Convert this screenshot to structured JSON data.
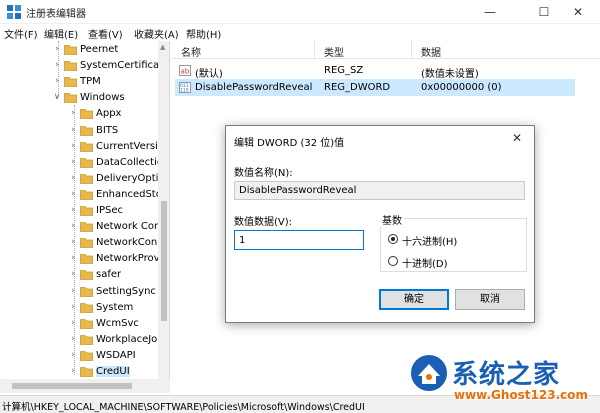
{
  "window": {
    "title": "注册表编辑器"
  },
  "menu": [
    "文件(F)",
    "编辑(E)",
    "查看(V)",
    "收藏夹(A)",
    "帮助(H)"
  ],
  "tree": {
    "items": [
      {
        "label": "Peernet",
        "indent": 1,
        "expanded": false
      },
      {
        "label": "SystemCertificate",
        "indent": 1,
        "expanded": false
      },
      {
        "label": "TPM",
        "indent": 1,
        "expanded": false
      },
      {
        "label": "Windows",
        "indent": 1,
        "expanded": true
      },
      {
        "label": "Appx",
        "indent": 2,
        "expanded": false
      },
      {
        "label": "BITS",
        "indent": 2,
        "expanded": false
      },
      {
        "label": "CurrentVersio",
        "indent": 2,
        "expanded": false
      },
      {
        "label": "DataCollection",
        "indent": 2,
        "expanded": false
      },
      {
        "label": "DeliveryOptin",
        "indent": 2,
        "expanded": false
      },
      {
        "label": "EnhancedStor",
        "indent": 2,
        "expanded": false
      },
      {
        "label": "IPSec",
        "indent": 2,
        "expanded": false
      },
      {
        "label": "Network Con",
        "indent": 2,
        "expanded": false
      },
      {
        "label": "NetworkConn",
        "indent": 2,
        "expanded": false
      },
      {
        "label": "NetworkProv",
        "indent": 2,
        "expanded": false
      },
      {
        "label": "safer",
        "indent": 2,
        "expanded": false
      },
      {
        "label": "SettingSync",
        "indent": 2,
        "expanded": false
      },
      {
        "label": "System",
        "indent": 2,
        "expanded": false
      },
      {
        "label": "WcmSvc",
        "indent": 2,
        "expanded": false
      },
      {
        "label": "WorkplaceJo",
        "indent": 2,
        "expanded": false
      },
      {
        "label": "WSDAPI",
        "indent": 2,
        "expanded": false
      },
      {
        "label": "CredUI",
        "indent": 2,
        "expanded": false,
        "selected": true
      }
    ]
  },
  "list": {
    "columns": [
      "名称",
      "类型",
      "数据"
    ],
    "rows": [
      {
        "name": "(默认)",
        "type": "REG_SZ",
        "data": "(数值未设置)",
        "icon": "string-value-icon",
        "selected": false
      },
      {
        "name": "DisablePasswordReveal",
        "type": "REG_DWORD",
        "data": "0x00000000 (0)",
        "icon": "dword-value-icon",
        "selected": true
      }
    ]
  },
  "dialog": {
    "title": "编辑 DWORD (32 位)值",
    "name_label": "数值名称(N):",
    "name_value": "DisablePasswordReveal",
    "data_label": "数值数据(V):",
    "data_value": "1",
    "radix_label": "基数",
    "radix_hex": "十六进制(H)",
    "radix_dec": "十进制(D)",
    "radix_selected": "hex",
    "ok": "确定",
    "cancel": "取消"
  },
  "status": {
    "path": "计算机\\HKEY_LOCAL_MACHINE\\SOFTWARE\\Policies\\Microsoft\\Windows\\CredUI"
  },
  "watermark": {
    "text": "系统之家",
    "url": "www.Ghost123.com"
  },
  "colors": {
    "folder": "#e8b84a",
    "selection": "#cce8ff",
    "accent": "#0078d7",
    "watermark_blue": "#1a5fb4",
    "watermark_orange": "#e8700a"
  }
}
